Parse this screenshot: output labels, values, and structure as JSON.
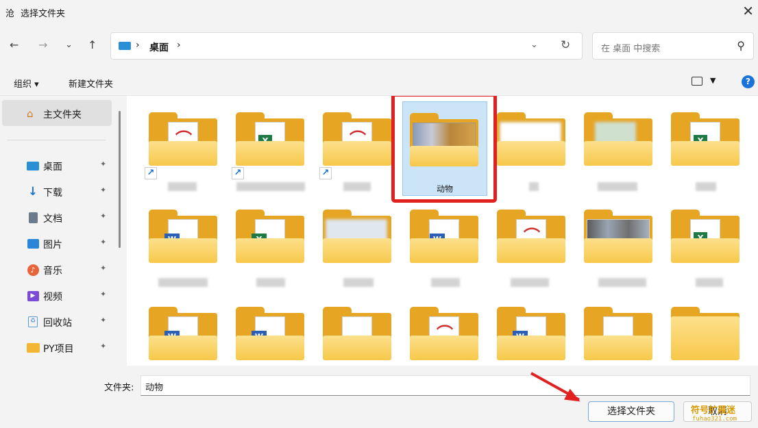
{
  "window": {
    "title": "选择文件夹",
    "app_icon_glyph": "沧",
    "close_glyph": "✕"
  },
  "nav": {
    "back": "←",
    "forward": "→",
    "recent": "⌄",
    "up": "↑"
  },
  "address": {
    "location": "桌面",
    "sep": "›",
    "dropdown": "⌄",
    "refresh": "↻"
  },
  "search": {
    "placeholder": "在 桌面 中搜索",
    "icon": "⚲"
  },
  "toolbar": {
    "organize": "组织 ▾",
    "new_folder": "新建文件夹",
    "help": "?"
  },
  "sidebar": {
    "home": "主文件夹",
    "items": [
      {
        "label": "桌面",
        "icon": "desktop-icon",
        "color": "#2b8fd6"
      },
      {
        "label": "下载",
        "icon": "download-icon",
        "color": "#1a73d9"
      },
      {
        "label": "文档",
        "icon": "document-icon",
        "color": "#6b7a8c"
      },
      {
        "label": "图片",
        "icon": "pictures-icon",
        "color": "#2a86d9"
      },
      {
        "label": "音乐",
        "icon": "music-icon",
        "color": "#e8643a"
      },
      {
        "label": "视频",
        "icon": "video-icon",
        "color": "#7b4bd8"
      },
      {
        "label": "回收站",
        "icon": "recycle-bin-icon",
        "color": "#5a9bd8"
      },
      {
        "label": "PY项目",
        "icon": "folder-icon",
        "color": "#f2b632"
      }
    ],
    "pin_glyph": "📌"
  },
  "content": {
    "selected_folder": "动物"
  },
  "footer": {
    "folder_label": "文件夹:",
    "folder_value": "动物",
    "select_button": "选择文件夹",
    "cancel_button": "取消"
  },
  "watermark": {
    "text": "符号扩展迷",
    "sub": "fuhao321.com"
  }
}
